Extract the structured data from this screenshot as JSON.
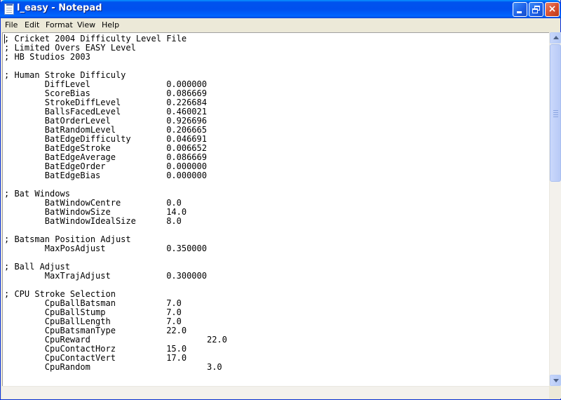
{
  "window": {
    "title": "l_easy - Notepad",
    "controls": {
      "minimize": "minimize",
      "maximize": "restore",
      "close": "×"
    }
  },
  "menu": {
    "items": [
      "File",
      "Edit",
      "Format",
      "View",
      "Help"
    ]
  },
  "editor": {
    "text": "; Cricket 2004 Difficulty Level File\n; Limited Overs EASY Level\n; HB Studios 2003\n\n; Human Stroke Difficuly\n\tDiffLevel\t\t0.000000\n\tScoreBias\t\t0.086669\n\tStrokeDiffLevel\t\t0.226684\n\tBallsFacedLevel\t\t0.460021\n\tBatOrderLevel\t\t0.926696\n\tBatRandomLevel\t\t0.206665\n\tBatEdgeDifficulty\t0.046691\n\tBatEdgeStroke\t\t0.006652\n\tBatEdgeAverage\t\t0.086669\n\tBatEdgeOrder\t\t0.000000\n\tBatEdgeBias\t\t0.000000\n\n; Bat Windows\n\tBatWindowCentre\t\t0.0\n\tBatWindowSize\t\t14.0\n\tBatWindowIdealSize\t8.0\n\n; Batsman Position Adjust\n\tMaxPosAdjust\t\t0.350000\n\n; Ball Adjust\n\tMaxTrajAdjust\t\t0.300000\n\n; CPU Stroke Selection\n\tCpuBallBatsman\t\t7.0\n\tCpuBallStump\t\t7.0\n\tCpuBallLength\t\t7.0\n\tCpuBatsmanType\t\t22.0\n\tCpuReward\t\t\t22.0\n\tCpuContactHorz\t\t15.0\n\tCpuContactVert\t\t17.0\n\tCpuRandom\t\t\t3.0"
  },
  "colors": {
    "titlebar": "#0053ee",
    "close_button": "#d9502d",
    "chrome": "#ece9d8"
  }
}
